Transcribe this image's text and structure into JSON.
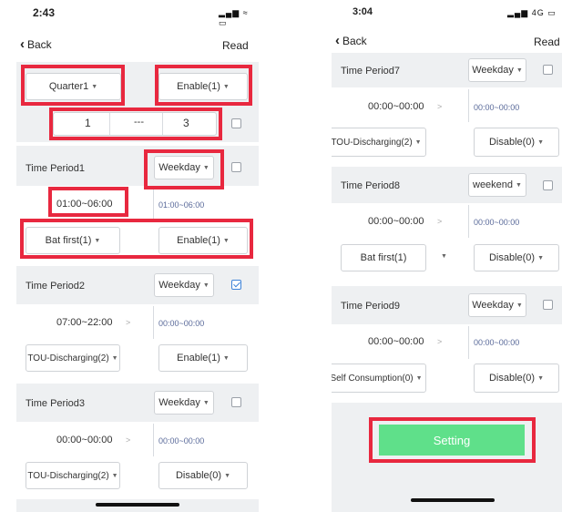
{
  "left": {
    "status_time": "2:43",
    "status_icons": "▂▄▆ ≈ ▭",
    "back_label": "Back",
    "read_label": "Read",
    "quarter_select": "Quarter1",
    "quarter_enable": "Enable(1)",
    "range_from": "1",
    "range_sep": "---",
    "range_to": "3",
    "periods": [
      {
        "title": "Time Period1",
        "day": "Weekday",
        "time": "01:00~06:00",
        "time_sub": "01:00~06:00",
        "mode": "Bat first(1)",
        "state": "Enable(1)",
        "checked": false
      },
      {
        "title": "Time Period2",
        "day": "Weekday",
        "time": "07:00~22:00",
        "time_sub": "00:00~00:00",
        "mode": "TOU-Discharging(2)",
        "state": "Enable(1)",
        "checked": true
      },
      {
        "title": "Time Period3",
        "day": "Weekday",
        "time": "00:00~00:00",
        "time_sub": "00:00~00:00",
        "mode": "TOU-Discharging(2)",
        "state": "Disable(0)",
        "checked": false
      }
    ]
  },
  "right": {
    "status_time": "3:04",
    "status_icons": "▂▄▆ 4G ▭",
    "back_label": "Back",
    "read_label": "Read",
    "periods": [
      {
        "title": "Time Period7",
        "day": "Weekday",
        "time": "00:00~00:00",
        "time_sub": "00:00~00:00",
        "mode": "TOU-Discharging(2)",
        "state": "Disable(0)",
        "checked": false
      },
      {
        "title": "Time Period8",
        "day": "weekend",
        "time": "00:00~00:00",
        "time_sub": "00:00~00:00",
        "mode": "Bat first(1)",
        "state": "Disable(0)",
        "checked": false
      },
      {
        "title": "Time Period9",
        "day": "Weekday",
        "time": "00:00~00:00",
        "time_sub": "00:00~00:00",
        "mode": "Self Consumption(0)",
        "state": "Disable(0)",
        "checked": false
      }
    ],
    "setting_label": "Setting"
  },
  "colors": {
    "highlight": "#e8283f",
    "setting_green": "#5fe08a",
    "checkbox_blue": "#3d82d8",
    "band_gray": "#eef0f2"
  }
}
